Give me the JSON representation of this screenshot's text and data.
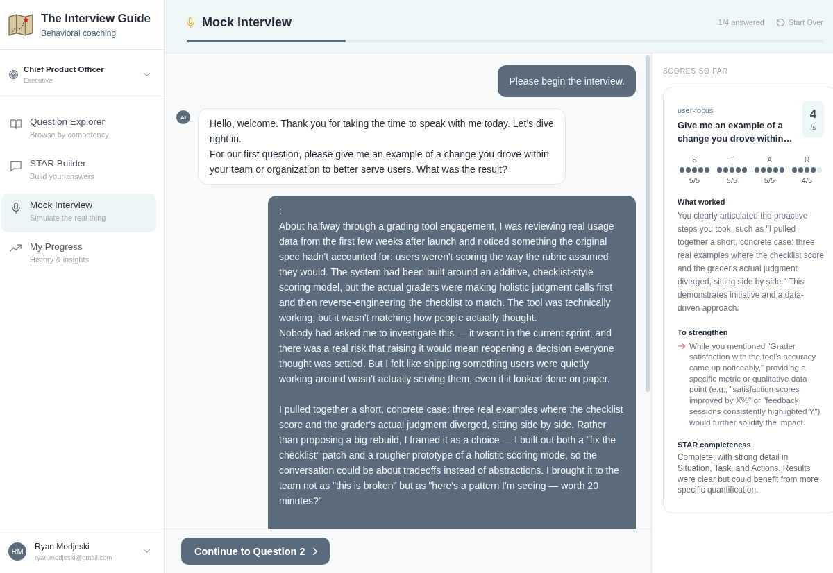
{
  "app": {
    "title": "The Interview Guide",
    "subtitle": "Behavioral coaching"
  },
  "role": {
    "title": "Chief Product Officer",
    "tier": "Executive"
  },
  "nav": [
    {
      "kind": "book",
      "label": "Question Explorer",
      "description": "Browse by competency",
      "selected": false
    },
    {
      "kind": "chat",
      "label": "STAR Builder",
      "description": "Build your answers",
      "selected": false
    },
    {
      "kind": "mic",
      "label": "Mock Interview",
      "description": "Simulate the real thing",
      "selected": true
    },
    {
      "kind": "trend",
      "label": "My Progress",
      "description": "History & insights",
      "selected": false
    }
  ],
  "user": {
    "initials": "RM",
    "name": "Ryan Modjeski",
    "email": "ryan.modjeski@gmail.com"
  },
  "header": {
    "title": "Mock Interview",
    "answered": "1/4 answered",
    "start_over": "Start Over",
    "progress": {
      "level": 0.25
    }
  },
  "messages": [
    {
      "kind": "user",
      "text": "Please begin the interview."
    },
    {
      "kind": "assistant",
      "avatar": "AI",
      "text": "Hello, welcome. Thank you for taking the time to speak with me today. Let’s dive right in.\nFor our first question, please give me an example of a change you drove within your team or organization to better serve users. What was the result?"
    },
    {
      "kind": "user",
      "text": ":\nAbout halfway through a grading tool engagement, I was reviewing real usage data from the first few weeks after launch and noticed something the original spec hadn't accounted for: users weren't scoring the way the rubric assumed they would. The system had been built around an additive, checklist-style scoring model, but the actual graders were making holistic judgment calls first and then reverse-engineering the checklist to match. The tool was technically working, but it wasn't matching how people actually thought.\nNobody had asked me to investigate this — it wasn't in the current sprint, and there was a real risk that raising it would mean reopening a decision everyone thought was settled. But I felt like shipping something users were quietly working around wasn't actually serving them, even if it looked done on paper.\n\nI pulled together a short, concrete case: three real examples where the checklist score and the grader's actual judgment diverged, sitting side by side. Rather than proposing a big rebuild, I framed it as a choice — I built out both a \"fix the checklist\" patch and a rougher prototype of a holistic scoring mode, so the conversation could be about tradeoffs instead of abstractions. I brought it to the team not as \"this is broken\" but as \"here's a pattern I'm seeing — worth 20 minutes?\""
    }
  ],
  "continue_button": "Continue to Question 2",
  "scores": {
    "heading": "SCORES SO FAR",
    "cards": [
      {
        "tag": "user-focus",
        "question": "Give me an example of a change you drove within…",
        "score": "4",
        "out_of": "/5",
        "star": [
          {
            "letter": "S",
            "stars": 5,
            "reading": "5/5"
          },
          {
            "letter": "T",
            "stars": 5,
            "reading": "5/5"
          },
          {
            "letter": "A",
            "stars": 5,
            "reading": "5/5"
          },
          {
            "letter": "R",
            "stars": 4,
            "reading": "4/5"
          }
        ],
        "sections": [
          {
            "kind": "praise",
            "title": "What worked",
            "text": "You clearly articulated the proactive steps you took, such as \"I pulled together a short, concrete case: three real examples where the checklist score and the grader's actual judgment diverged, sitting side by side.\" This demonstrates initiative and a data-driven approach."
          },
          {
            "kind": "bullets",
            "title": "To strengthen",
            "items": [
              "While you mentioned \"Grader satisfaction with the tool's accuracy came up noticeably,\" providing a specific metric or qualitative data point (e.g., \"satisfaction scores improved by X%\" or \"feedback sessions consistently highlighted Y\") would further solidify the impact."
            ]
          },
          {
            "kind": "summary",
            "title": "STAR completeness",
            "text": "Complete, with strong detail in Situation, Task, and Actions. Results were clear but could benefit from more specific quantification."
          }
        ]
      }
    ]
  }
}
